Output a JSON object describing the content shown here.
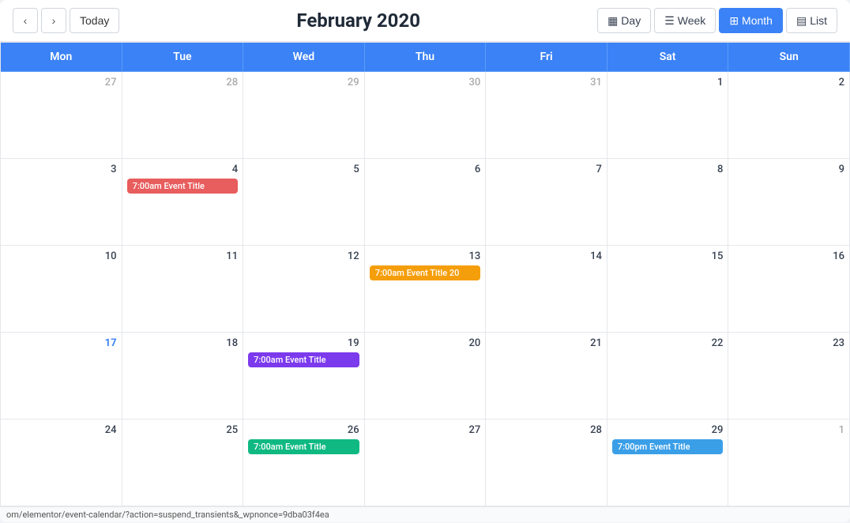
{
  "header": {
    "title": "February 2020",
    "today_label": "Today",
    "prev_icon": "‹",
    "next_icon": "›",
    "views": [
      {
        "id": "day",
        "label": "Day",
        "icon": "▦",
        "active": false
      },
      {
        "id": "week",
        "label": "Week",
        "icon": "☰",
        "active": false
      },
      {
        "id": "month",
        "label": "Month",
        "icon": "⊞",
        "active": true
      },
      {
        "id": "list",
        "label": "List",
        "icon": "▤",
        "active": false
      }
    ]
  },
  "day_headers": [
    "Mon",
    "Tue",
    "Wed",
    "Thu",
    "Fri",
    "Sat",
    "Sun"
  ],
  "weeks": [
    [
      {
        "num": "27",
        "other": true,
        "events": []
      },
      {
        "num": "28",
        "other": true,
        "events": []
      },
      {
        "num": "29",
        "other": true,
        "events": []
      },
      {
        "num": "30",
        "other": true,
        "events": []
      },
      {
        "num": "31",
        "other": true,
        "events": []
      },
      {
        "num": "1",
        "other": false,
        "events": []
      },
      {
        "num": "2",
        "other": false,
        "events": []
      }
    ],
    [
      {
        "num": "3",
        "other": false,
        "events": []
      },
      {
        "num": "4",
        "other": false,
        "events": [
          {
            "label": "7:00am Event Title",
            "color": "event-red"
          }
        ]
      },
      {
        "num": "5",
        "other": false,
        "events": []
      },
      {
        "num": "6",
        "other": false,
        "events": []
      },
      {
        "num": "7",
        "other": false,
        "events": []
      },
      {
        "num": "8",
        "other": false,
        "events": []
      },
      {
        "num": "9",
        "other": false,
        "events": []
      }
    ],
    [
      {
        "num": "10",
        "other": false,
        "events": []
      },
      {
        "num": "11",
        "other": false,
        "events": []
      },
      {
        "num": "12",
        "other": false,
        "events": []
      },
      {
        "num": "13",
        "other": false,
        "events": [
          {
            "label": "7:00am Event Title 20",
            "color": "event-orange"
          }
        ]
      },
      {
        "num": "14",
        "other": false,
        "events": []
      },
      {
        "num": "15",
        "other": false,
        "events": []
      },
      {
        "num": "16",
        "other": false,
        "events": []
      }
    ],
    [
      {
        "num": "17",
        "other": false,
        "today": true,
        "events": []
      },
      {
        "num": "18",
        "other": false,
        "events": []
      },
      {
        "num": "19",
        "other": false,
        "events": [
          {
            "label": "7:00am Event Title",
            "color": "event-purple"
          }
        ]
      },
      {
        "num": "20",
        "other": false,
        "events": []
      },
      {
        "num": "21",
        "other": false,
        "events": []
      },
      {
        "num": "22",
        "other": false,
        "events": []
      },
      {
        "num": "23",
        "other": false,
        "events": []
      }
    ],
    [
      {
        "num": "24",
        "other": false,
        "events": []
      },
      {
        "num": "25",
        "other": false,
        "events": []
      },
      {
        "num": "26",
        "other": false,
        "events": [
          {
            "label": "7:00am Event Title",
            "color": "event-green"
          }
        ]
      },
      {
        "num": "27",
        "other": false,
        "events": []
      },
      {
        "num": "28",
        "other": false,
        "events": []
      },
      {
        "num": "29",
        "other": false,
        "events": [
          {
            "label": "7:00pm Event Title",
            "color": "event-blue"
          }
        ]
      },
      {
        "num": "1",
        "other": true,
        "events": []
      }
    ]
  ],
  "status_bar": "om/elementor/event-calendar/?action=suspend_transients&_wpnonce=9dba03f4ea"
}
